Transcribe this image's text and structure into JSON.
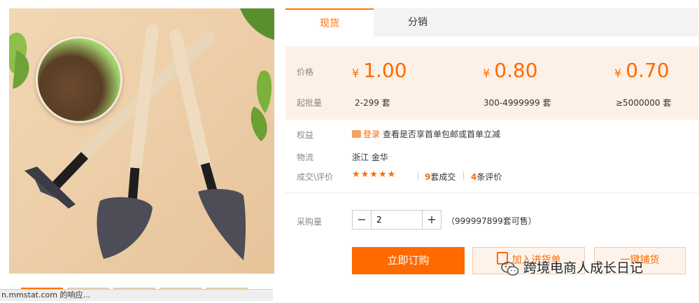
{
  "tabs": [
    {
      "label": "现货",
      "active": true
    },
    {
      "label": "分销",
      "active": false
    }
  ],
  "price_panel": {
    "price_label": "价格",
    "moq_label": "起批量",
    "currency": "¥",
    "tiers": [
      {
        "price": "1.00",
        "range": "2-299 套"
      },
      {
        "price": "0.80",
        "range": "300-4999999 套"
      },
      {
        "price": "0.70",
        "range": "≥5000000 套"
      }
    ]
  },
  "rights": {
    "label": "权益",
    "login_link": "登录",
    "text": "查看是否享首单包邮或首单立减"
  },
  "logistics": {
    "label": "物流",
    "value": "浙江 金华"
  },
  "reviews": {
    "label": "成交\\评价",
    "stars": "★★★★★",
    "deals_count": "9",
    "deals_suffix": "套成交",
    "review_count": "4",
    "review_suffix": "条评价"
  },
  "purchase": {
    "label": "采购量",
    "quantity": "2",
    "stock_note": "（999997899套可售）"
  },
  "buttons": {
    "buy_now": "立即订购",
    "add_to_list": "加入进货单",
    "one_click": "一键铺货"
  },
  "watermark": "跨境电商人成长日记",
  "status_bar": "n.mmstat.com 的响应...",
  "colors": {
    "accent": "#ff6a00",
    "price_bg": "#fdf1e7"
  },
  "icons": {
    "minus": "minus-icon",
    "plus": "plus-icon",
    "coupon": "coupon-icon",
    "list": "list-icon",
    "wechat": "wechat-logo"
  }
}
